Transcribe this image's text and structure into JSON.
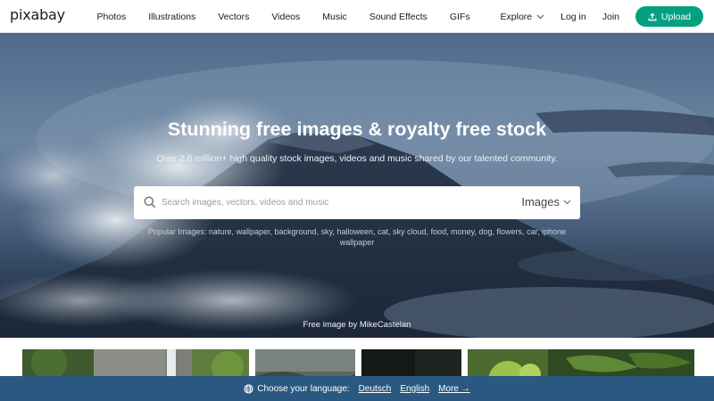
{
  "header": {
    "logo": "pixabay",
    "nav": [
      "Photos",
      "Illustrations",
      "Vectors",
      "Videos",
      "Music",
      "Sound Effects",
      "GIFs"
    ],
    "explore": "Explore",
    "login": "Log in",
    "join": "Join",
    "upload": "Upload",
    "accent_color": "#05a081"
  },
  "hero": {
    "title": "Stunning free images & royalty free stock",
    "subtitle": "Over 2.6 million+ high quality stock images, videos and music shared by our talented community.",
    "search_placeholder": "Search images, vectors, videos and music",
    "search_type": "Images",
    "popular_label": "Popular Images:",
    "popular_tags": [
      "nature",
      "wallpaper",
      "background",
      "sky",
      "halloween",
      "cat",
      "sky cloud",
      "food",
      "money",
      "dog",
      "flowers",
      "car",
      "iphone",
      "wallpaper"
    ],
    "credit": "Free image by MikeCastelan"
  },
  "language_bar": {
    "choose_label": "Choose your language:",
    "languages": [
      "Deutsch",
      "English"
    ],
    "more": "More →",
    "background_color": "#2a5881"
  }
}
